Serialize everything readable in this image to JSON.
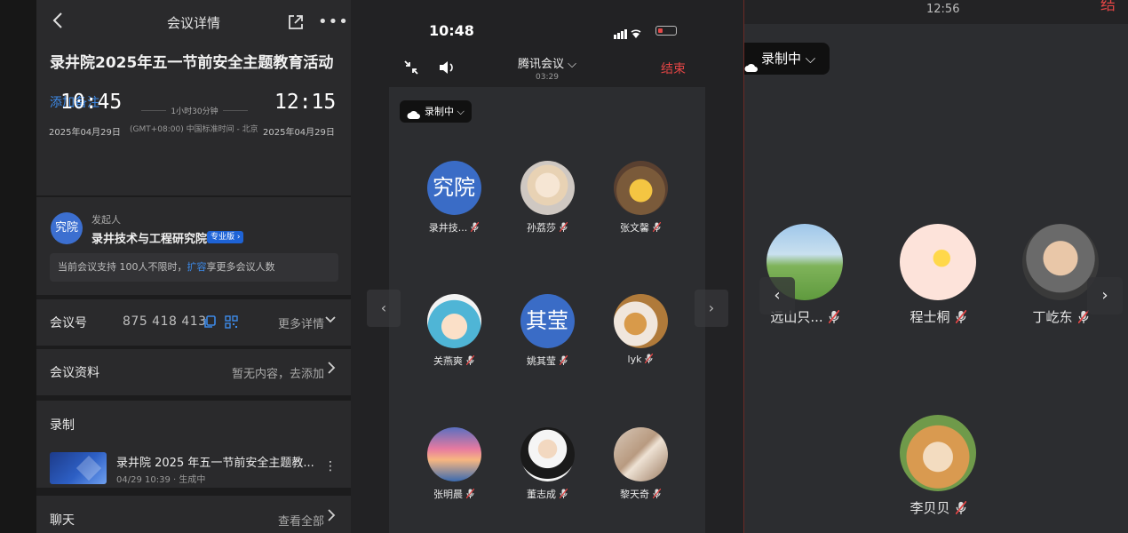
{
  "details": {
    "nav_title": "会议详情",
    "meeting_title": "录井院2025年五一节前安全主题教育活动",
    "add_note": "添加备注",
    "start_time": "10:45",
    "end_time": "12:15",
    "duration": "1小时30分钟",
    "start_date": "2025年04月29日",
    "end_date": "2025年04月29日",
    "timezone": "(GMT+08:00) 中国标准时间 - 北京",
    "host_avatar": "究院",
    "host_label": "发起人",
    "host_name": "录井技术与工程研究院",
    "edition_badge": "专业版",
    "capacity_tip_a": "当前会议支持 100人不限时，",
    "capacity_tip_link": "扩容",
    "capacity_tip_b": "享更多会议人数",
    "meeting_id_label": "会议号",
    "meeting_id": "875 418 413",
    "more_details": "更多详情",
    "materials_label": "会议资料",
    "materials_value": "暂无内容，去添加",
    "recording_label": "录制",
    "recording_title": "录井院 2025 年五一节前安全主题教...",
    "recording_meta": "04/29 10:39 · 生成中",
    "chat_label": "聊天",
    "chat_value": "查看全部"
  },
  "phone": {
    "clock": "10:48",
    "app_name": "腾讯会议",
    "elapsed": "03:29",
    "end_label": "结束",
    "recording_pill": "录制中",
    "participants": [
      {
        "name": "录井技...",
        "avatar_text": "究院",
        "avatar": "text-avatar",
        "host": true
      },
      {
        "name": "孙荔莎",
        "avatar": "anime-girl-photo"
      },
      {
        "name": "张文馨",
        "avatar": "pikachu-photo"
      },
      {
        "name": "关燕爽",
        "avatar": "cartoon-girl-photo"
      },
      {
        "name": "姚其莹",
        "avatar_text": "其莹",
        "avatar": "text-avatar"
      },
      {
        "name": "lyk",
        "avatar": "dogs-photo"
      },
      {
        "name": "张明晨",
        "avatar": "sunset-clouds-photo"
      },
      {
        "name": "董志成",
        "avatar": "boss-baby-photo"
      },
      {
        "name": "黎天奇",
        "avatar": "open-book-photo"
      }
    ]
  },
  "zoomed": {
    "clock": "12:56",
    "end_label": "结",
    "recording_pill": "录制中",
    "participants": [
      {
        "name": "远山只...",
        "avatar": "meadow-girl-photo"
      },
      {
        "name": "程士桐",
        "avatar": "rainbow-star-icon"
      },
      {
        "name": "丁屹东",
        "avatar": "baby-photo"
      },
      {
        "name": "李贝贝",
        "avatar": "shiba-dog-photo"
      }
    ]
  }
}
